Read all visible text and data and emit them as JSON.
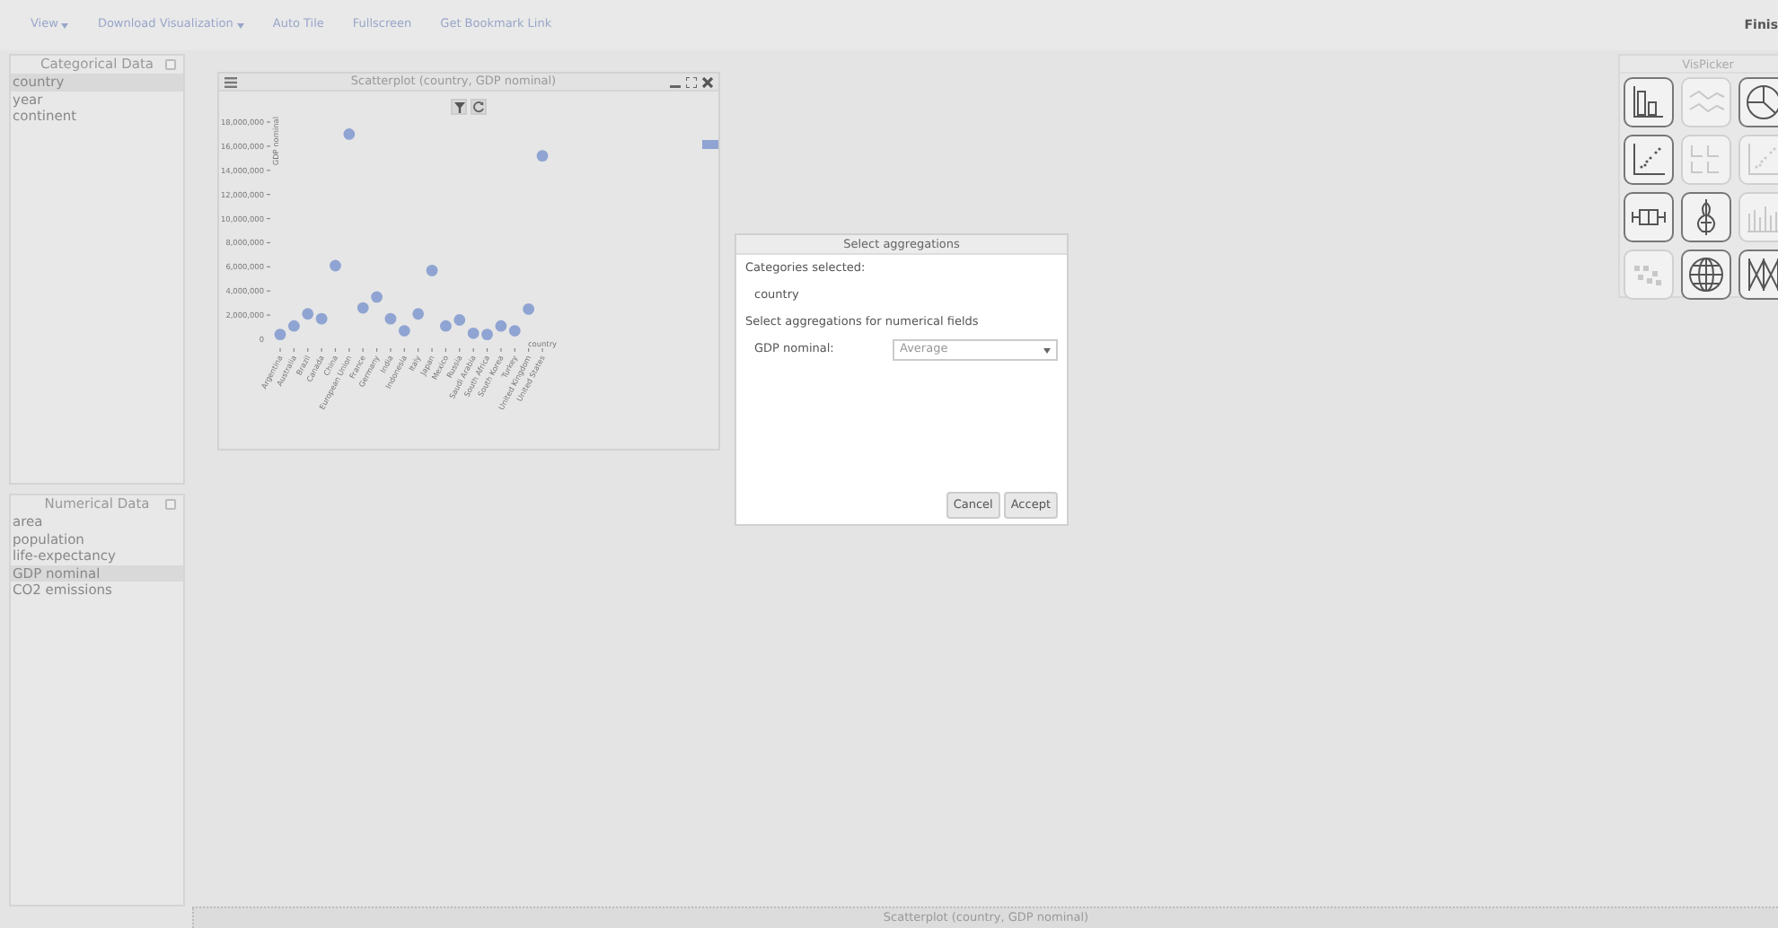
{
  "menu": [
    {
      "label": "View",
      "dropdown": true
    },
    {
      "label": "Download Visualization",
      "dropdown": true
    },
    {
      "label": "Auto Tile",
      "dropdown": false
    },
    {
      "label": "Fullscreen",
      "dropdown": false
    },
    {
      "label": "Get Bookmark Link",
      "dropdown": false
    }
  ],
  "menu_right": "Finis",
  "categorical_panel": {
    "title": "Categorical Data",
    "checked": false,
    "items": [
      {
        "label": "country",
        "selected": true
      },
      {
        "label": "year",
        "selected": false
      },
      {
        "label": "continent",
        "selected": false
      }
    ]
  },
  "numerical_panel": {
    "title": "Numerical Data",
    "checked": false,
    "items": [
      {
        "label": "area",
        "selected": false
      },
      {
        "label": "population",
        "selected": false
      },
      {
        "label": "life-expectancy",
        "selected": false
      },
      {
        "label": "GDP nominal",
        "selected": true
      },
      {
        "label": "CO2 emissions",
        "selected": false
      }
    ]
  },
  "chart_window": {
    "title": "Scatterplot (country, GDP nominal)",
    "chart_data": {
      "type": "scatter",
      "xlabel": "country",
      "ylabel": "GDP nominal",
      "categories": [
        "Argentina",
        "Australia",
        "Brazil",
        "Canada",
        "China",
        "European Union",
        "France",
        "Germany",
        "India",
        "Indonesia",
        "Italy",
        "Japan",
        "Mexico",
        "Russia",
        "Saudi Arabia",
        "South Africa",
        "South Korea",
        "Turkey",
        "United Kingdom",
        "United States"
      ],
      "series": [
        {
          "color": "#8fa4d2",
          "values": [
            400000,
            1100000,
            2100000,
            1700000,
            6100000,
            17000000,
            2600000,
            3500000,
            1700000,
            700000,
            2100000,
            5700000,
            1100000,
            1600000,
            500000,
            400000,
            1100000,
            700000,
            2500000,
            15200000
          ]
        }
      ],
      "ylim": [
        0,
        18000000
      ],
      "yticks": [
        {
          "value": 0,
          "label": "0"
        },
        {
          "value": 2000000,
          "label": "2,000,000"
        },
        {
          "value": 4000000,
          "label": "4,000,000"
        },
        {
          "value": 6000000,
          "label": "6,000,000"
        },
        {
          "value": 8000000,
          "label": "8,000,000"
        },
        {
          "value": 10000000,
          "label": "10,000,000"
        },
        {
          "value": 12000000,
          "label": "12,000,000"
        },
        {
          "value": 14000000,
          "label": "14,000,000"
        },
        {
          "value": 16000000,
          "label": "16,000,000"
        },
        {
          "value": 18000000,
          "label": "18,000,000"
        }
      ]
    }
  },
  "dialog": {
    "title": "Select aggregations",
    "categories_label": "Categories selected:",
    "categories": [
      "country"
    ],
    "aggregations_label": "Select aggregations for numerical fields",
    "fields": [
      {
        "label": "GDP nominal:",
        "value": "Average"
      }
    ],
    "buttons": [
      "Cancel",
      "Accept"
    ]
  },
  "vispicker": {
    "title": "VisPicker",
    "items": [
      {
        "kind": "bar",
        "enabled": true
      },
      {
        "kind": "line",
        "enabled": false
      },
      {
        "kind": "pie",
        "enabled": true
      },
      {
        "kind": "scatter",
        "enabled": true
      },
      {
        "kind": "matrix",
        "enabled": false
      },
      {
        "kind": "scatter",
        "enabled": false
      },
      {
        "kind": "boxplot",
        "enabled": true
      },
      {
        "kind": "violin",
        "enabled": true
      },
      {
        "kind": "histogram",
        "enabled": false
      },
      {
        "kind": "heatmap",
        "enabled": false
      },
      {
        "kind": "globe",
        "enabled": true
      },
      {
        "kind": "parallel",
        "enabled": true
      }
    ]
  },
  "taskbar": [
    {
      "label": "Scatterplot (country, GDP nominal)"
    }
  ]
}
